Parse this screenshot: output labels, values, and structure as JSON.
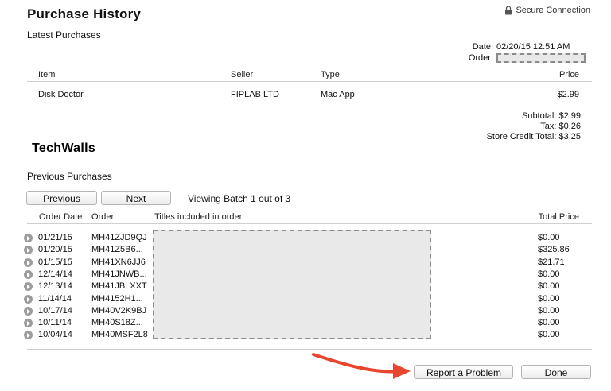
{
  "header": {
    "title": "Purchase History",
    "secure_label": "Secure Connection",
    "lock_icon": "lock-icon"
  },
  "latest": {
    "label": "Latest Purchases",
    "date_label": "Date:",
    "date_value": "02/20/15 12:51 AM",
    "order_label": "Order:",
    "columns": {
      "item": "Item",
      "seller": "Seller",
      "type": "Type",
      "price": "Price"
    },
    "row": {
      "item": "Disk Doctor",
      "seller": "FIPLAB LTD",
      "type": "Mac App",
      "price": "$2.99"
    },
    "subtotal": "Subtotal: $2.99",
    "tax": "Tax: $0.26",
    "store_credit": "Store Credit Total: $3.25"
  },
  "watermark": "TechWalls",
  "previous": {
    "label": "Previous Purchases",
    "prev_button": "Previous",
    "next_button": "Next",
    "batch_text": "Viewing Batch 1 out of 3",
    "columns": {
      "date": "Order Date",
      "order": "Order",
      "titles": "Titles included in order",
      "total": "Total Price"
    },
    "rows": [
      {
        "date": "01/21/15",
        "order": "MH41ZJD9QJ",
        "price": "$0.00"
      },
      {
        "date": "01/20/15",
        "order": "MH41Z5B6...",
        "price": "$325.86"
      },
      {
        "date": "01/15/15",
        "order": "MH41XN6JJ6",
        "price": "$21.71"
      },
      {
        "date": "12/14/14",
        "order": "MH41JNWB...",
        "price": "$0.00"
      },
      {
        "date": "12/13/14",
        "order": "MH41JBLXXT",
        "price": "$0.00"
      },
      {
        "date": "11/14/14",
        "order": "MH4152H1...",
        "price": "$0.00"
      },
      {
        "date": "10/17/14",
        "order": "MH40V2K9BJ",
        "price": "$0.00"
      },
      {
        "date": "10/11/14",
        "order": "MH40S18Z...",
        "price": "$0.00"
      },
      {
        "date": "10/04/14",
        "order": "MH40MSF2L8",
        "price": "$0.00"
      }
    ]
  },
  "footer": {
    "report_button": "Report a Problem",
    "done_button": "Done"
  },
  "colors": {
    "annotation_arrow": "#e8462e",
    "divider": "#cfcfcf",
    "redaction_fill": "#e9e9e9"
  }
}
